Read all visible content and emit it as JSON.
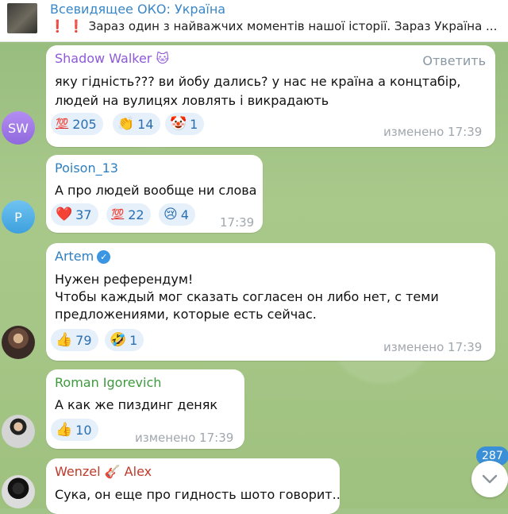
{
  "pinned": {
    "title": "Всевидящее ОКО: Україна",
    "excl": "❗ ❗",
    "text": "Зараз один з найважчих моментів нашої історії. Зараз Україна ..."
  },
  "messages": [
    {
      "author": "Shadow Walker",
      "author_emoji": "🐱",
      "author_color": "#8e59d6",
      "avatar_text": "SW",
      "reply_label": "Ответить",
      "lines": [
        "яку гідність??? ви йобу дались? у нас не країна а концтабір,",
        "людей на вулицях ловлять і викрадають"
      ],
      "reactions": [
        {
          "emoji": "💯",
          "count": "205"
        },
        {
          "emoji": "👏",
          "count": "14"
        },
        {
          "emoji": "🤡",
          "count": "1"
        }
      ],
      "time": "изменено 17:39"
    },
    {
      "author": "Poison_13",
      "author_color": "#2e7fc0",
      "avatar_text": "P",
      "lines": [
        "А про людей вообще ни слова"
      ],
      "reactions": [
        {
          "emoji": "❤️",
          "count": "37"
        },
        {
          "emoji": "💯",
          "count": "22"
        },
        {
          "emoji": "😢",
          "count": "4"
        }
      ],
      "time": "17:39"
    },
    {
      "author": "Artem",
      "author_color": "#2e7fc0",
      "lines": [
        "Нужен референдум!",
        "Чтобы каждый мог сказать согласен он либо нет, с теми",
        "предложениями, которые есть сейчас."
      ],
      "reactions": [
        {
          "emoji": "👍",
          "count": "79"
        },
        {
          "emoji": "🤣",
          "count": "1"
        }
      ],
      "time": "изменено 17:39"
    },
    {
      "author": "Roman Igorevich",
      "author_color": "#3d9a3d",
      "lines": [
        "А как же пиздинг деняк"
      ],
      "reactions": [
        {
          "emoji": "👍",
          "count": "10"
        }
      ],
      "time": "изменено 17:39"
    },
    {
      "author": "Wenzel",
      "author_emoji": "🎸",
      "author_last": "Alex",
      "author_color": "#c0392b",
      "lines": [
        "Сука, он еще про гидность шото говорит.."
      ]
    }
  ],
  "unread_count": "287"
}
